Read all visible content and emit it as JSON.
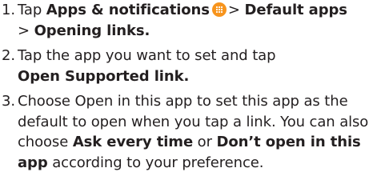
{
  "steps": [
    {
      "number": "1.",
      "t1": "Tap ",
      "b1": "Apps & notifications",
      "t2": "> ",
      "b2": "Default apps",
      "t3": "> ",
      "b3": "Opening links."
    },
    {
      "number": "2.",
      "t1": "Tap the app you want to set and tap",
      "b1": "Open Supported link."
    },
    {
      "number": "3.",
      "t1": "Choose Open in this app to set this app as the default to open when you tap a link. You can also choose ",
      "b1": "Ask every time",
      "t2": " or ",
      "b2": "Don’t open in this app",
      "t3": " according to your preference."
    }
  ],
  "icons": {
    "apps_icon": "apps-grid-icon",
    "apps_icon_color": "#f7941d"
  }
}
